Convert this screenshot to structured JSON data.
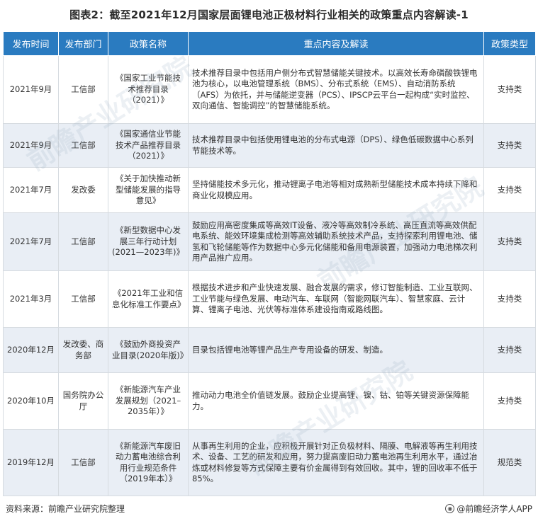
{
  "title": "图表2：截至2021年12月国家层面锂电池正极材料行业相关的政策重点内容解读-1",
  "columns": [
    "发布时间",
    "发布部门",
    "政策名称",
    "重点内容及解读",
    "政策类型"
  ],
  "rows": [
    {
      "date": "2021年9月",
      "dept": "工信部",
      "name": "《国家工业节能技术推荐目录（2021）》",
      "content": "技术推荐目录中包括用户侧分布式智慧储能关键技术。以高效长寿命磷酸铁锂电池为核心，以电池管理系统（BMS）、分布式系统（EMS）、自动消防系统（AFS）为依托，并与储能逆变器（PCS）、IPSCP云平台一起构成“实时监控、双向通信、智能调控”的智慧储能系统。",
      "type": "支持类"
    },
    {
      "date": "2021年9月",
      "dept": "工信部",
      "name": "《国家通信业节能技术产品推荐目录（2021）》",
      "content": "技术推荐目录中包括使用锂电池的分布式电源（DPS）、绿色低碳数据中心系列节能技术等。",
      "type": "支持类"
    },
    {
      "date": "2021年7月",
      "dept": "发改委",
      "name": "《关于加快推动新型储能发展的指导意见》",
      "content": "坚持储能技术多元化，推动锂离子电池等相对成熟新型储能技术成本持续下降和商业化规模应用。",
      "type": "支持类"
    },
    {
      "date": "2021年7月",
      "dept": "工信部",
      "name": "《新型数据中心发展三年行动计划(2021—2023年)》",
      "content": "鼓励应用高密度集成等高效IT设备、液冷等高效制冷系统、高压直流等高效供配电系统、能效环境集成检测等高效辅助系统技术产品，支持探索利用锂电池、储氢和飞轮储能等作为数据中心多元化储能和备用电源装置，加强动力电池梯次利用产品推广应用。",
      "type": "支持类"
    },
    {
      "date": "2021年3月",
      "dept": "工信部",
      "name": "《2021年工业和信息化标准工作要点》",
      "content": "根据技术进步和产业快速发展、融合发展的需求，修订智能制造、工业互联网、工业节能与绿色发展、电动汽车、车联网（智能网联汽车）、智慧家庭、云计算、锂离子电池、光伏等标准体系建设指南或路线图。",
      "type": "支持类"
    },
    {
      "date": "2020年12月",
      "dept": "发改委、商务部",
      "name": "《鼓励外商投资产业目录(2020年版)》",
      "content": "目录包括锂电池等锂产品生产专用设备的研发、制造。",
      "type": "支持类"
    },
    {
      "date": "2020年10月",
      "dept": "国务院办公厅",
      "name": "《新能源汽车产业发展规划（2021–2035年）》",
      "content": "推动动力电池全价值链发展。鼓励企业提高锂、镍、钴、铂等关键资源保障能力。",
      "type": "支持类"
    },
    {
      "date": "2019年12月",
      "dept": "工信部",
      "name": "《新能源汽车废旧动力蓄电池综合利用行业规范条件（2019年本）》",
      "content": "从事再生利用的企业，应积极开展针对正负极材料、隔膜、电解液等再生利用技术、设备、工艺的研发和应用，努力提高废旧动力蓄电池再生利用水平，通过冶炼或材料修复等方式保障主要有价金属得到有效回收。其中，锂的回收率不低于85%。",
      "type": "规范类"
    }
  ],
  "footer": {
    "source": "资料来源：前瞻产业研究院整理",
    "brand": "@前瞻经济学人APP"
  },
  "watermark_text": "前瞻产业研究院",
  "colors": {
    "header_bg": "#2a7bc0",
    "row_alt": "#e9eef5",
    "border": "#d6dbe0"
  }
}
